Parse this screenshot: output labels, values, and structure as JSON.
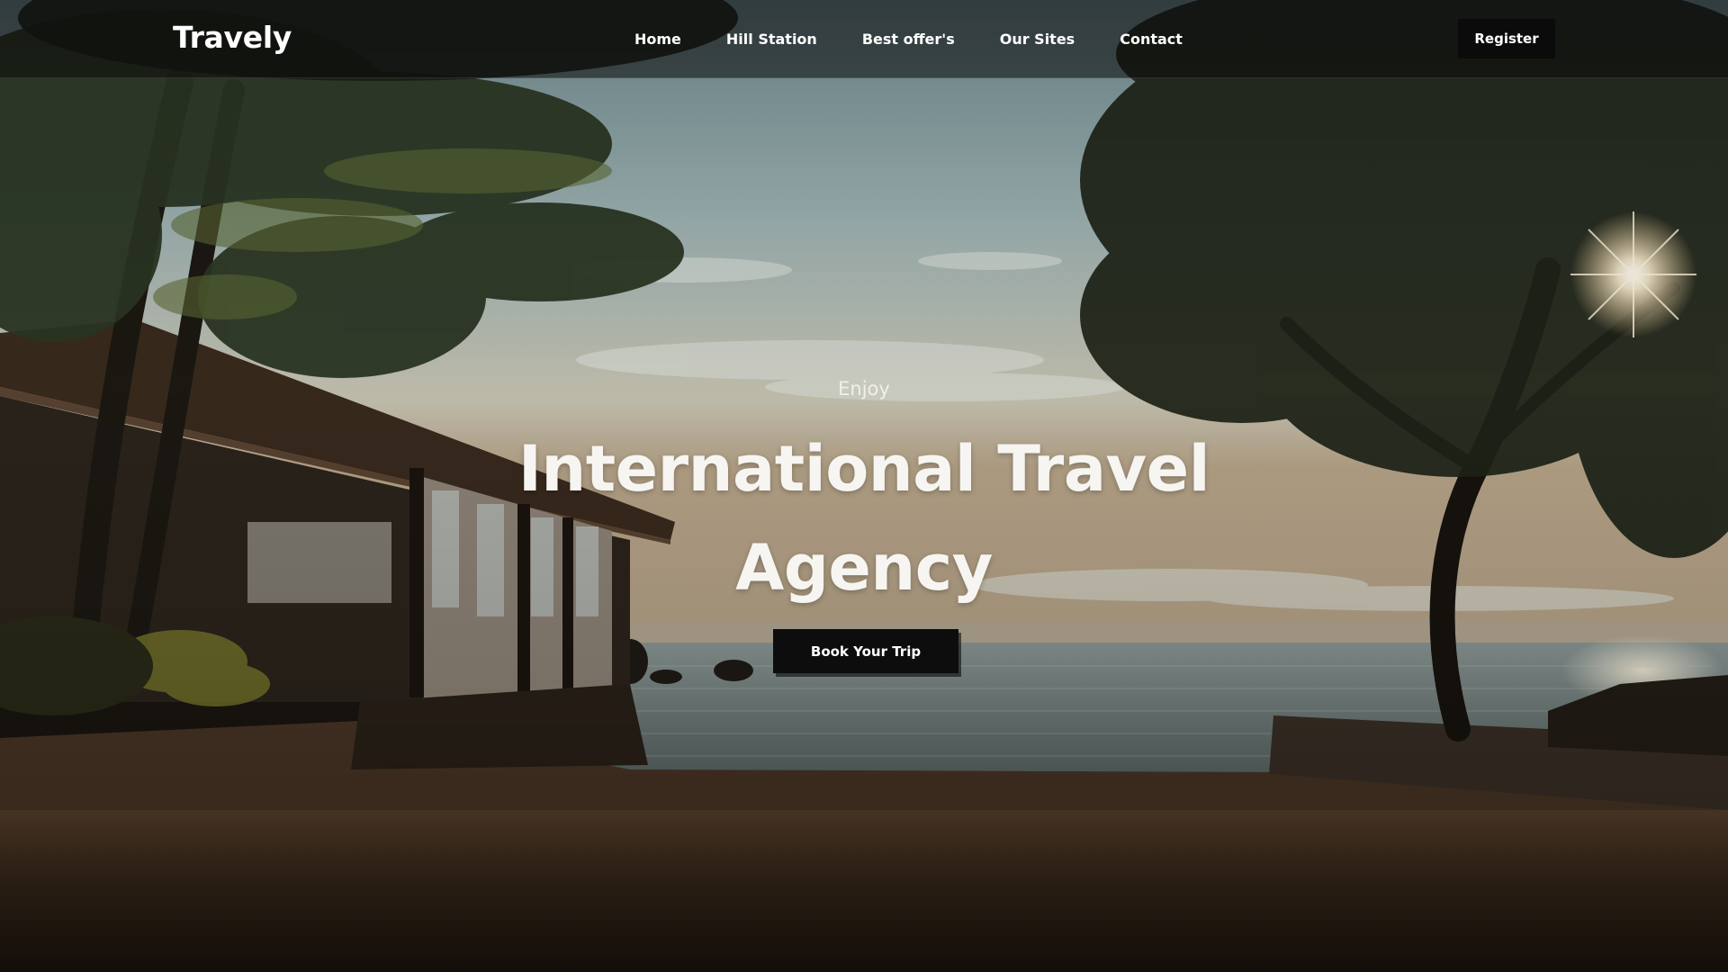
{
  "header": {
    "logo": "Travely",
    "nav": [
      {
        "label": "Home"
      },
      {
        "label": "Hill Station"
      },
      {
        "label": "Best offer's"
      },
      {
        "label": "Our Sites"
      },
      {
        "label": "Contact"
      }
    ],
    "register_label": "Register"
  },
  "hero": {
    "eyebrow": "Enjoy",
    "headline": "International Travel Agency",
    "cta_label": "Book Your Trip"
  },
  "colors": {
    "header_bg": "#0a0a0a",
    "button_bg": "#0b0b0b",
    "text": "#ffffff"
  }
}
